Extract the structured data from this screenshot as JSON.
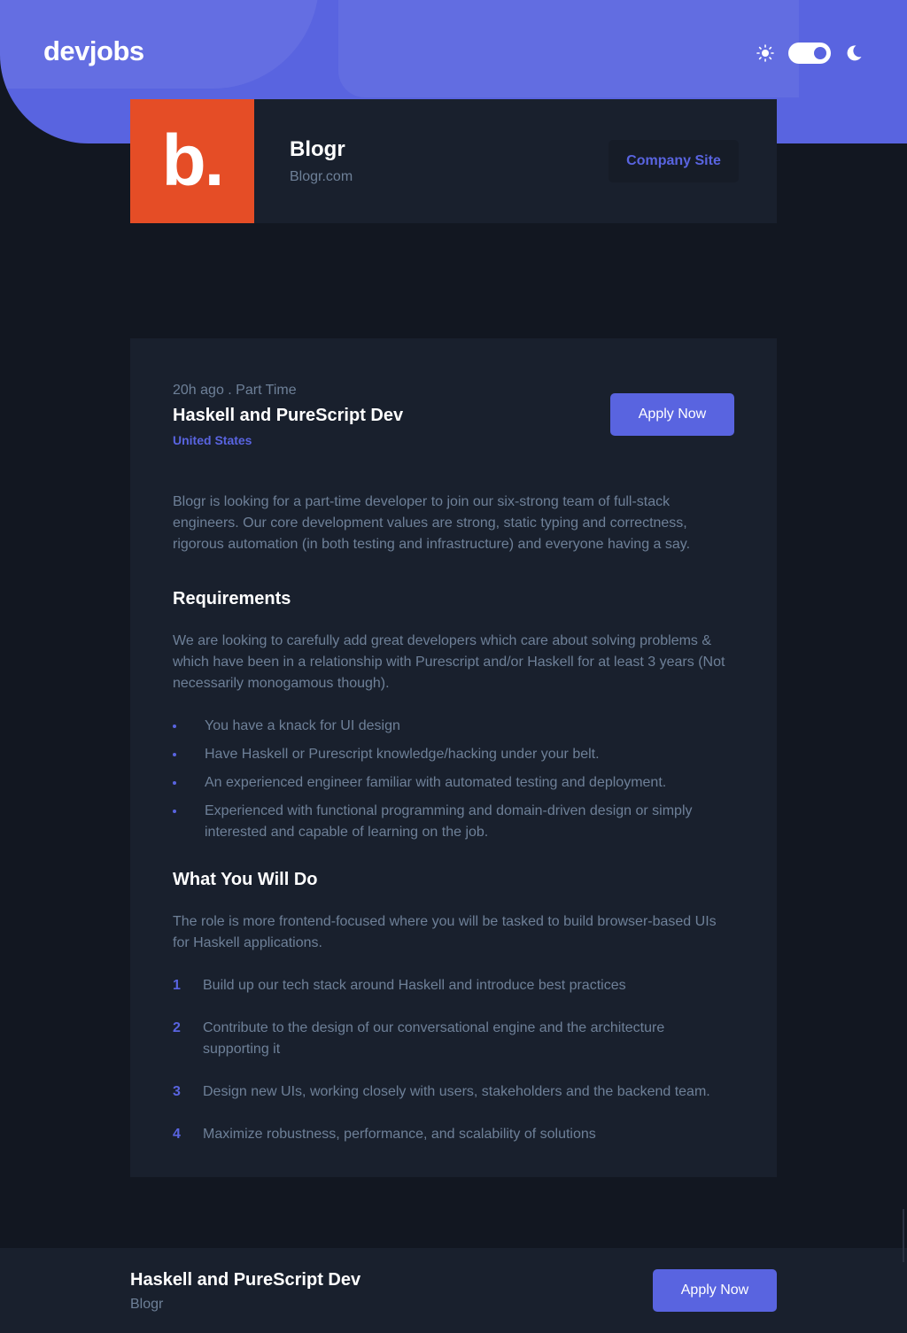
{
  "header": {
    "logo": "devjobs",
    "theme": {
      "sun_icon": "sun-icon",
      "moon_icon": "moon-icon",
      "dark_mode": true
    }
  },
  "company": {
    "logo_letter": "b.",
    "logo_color": "#E54D26",
    "name": "Blogr",
    "website": "Blogr.com",
    "site_button": "Company Site"
  },
  "job": {
    "meta": "20h ago . Part Time",
    "title": "Haskell and PureScript Dev",
    "location": "United States",
    "apply_label": "Apply Now",
    "description": "Blogr is looking for a part-time developer to join our six-strong team of full-stack engineers. Our core development values are strong, static typing and correctness, rigorous automation (in both testing and infrastructure) and everyone having a say.",
    "requirements": {
      "title": "Requirements",
      "content": "We are looking to carefully add great developers which care about solving problems & which have been in a relationship with Purescript and/or Haskell for at least 3 years (Not necessarily monogamous though).",
      "items": [
        "You have a knack for UI design",
        "Have Haskell or Purescript knowledge/hacking under your belt.",
        "An experienced engineer familiar with automated testing and deployment.",
        "Experienced with functional programming and domain-driven design or simply interested and capable of learning on the job."
      ]
    },
    "role": {
      "title": "What You Will Do",
      "content": "The role is more frontend-focused where you will be tasked to build browser-based UIs for Haskell applications.",
      "items": [
        {
          "num": "1",
          "text": "Build up our tech stack around Haskell and introduce best practices"
        },
        {
          "num": "2",
          "text": "Contribute to the design of our conversational engine and the architecture supporting it"
        },
        {
          "num": "3",
          "text": "Design new UIs, working closely with users, stakeholders and the backend team."
        },
        {
          "num": "4",
          "text": "Maximize robustness, performance, and scalability of solutions"
        }
      ]
    }
  },
  "footer": {
    "title": "Haskell and PureScript Dev",
    "company": "Blogr",
    "apply_label": "Apply Now"
  },
  "colors": {
    "accent": "#5964E0",
    "background": "#121721",
    "card": "#19202D",
    "muted_text": "#6E8098"
  }
}
